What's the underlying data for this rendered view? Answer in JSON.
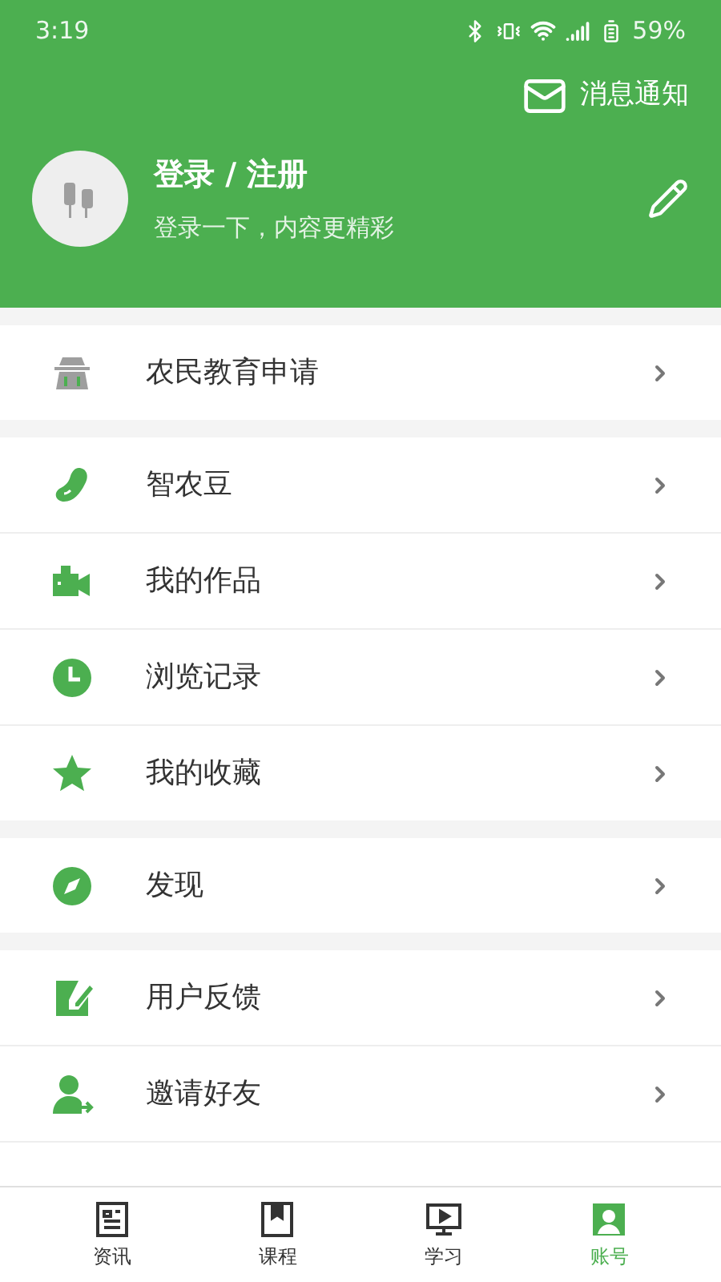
{
  "status_bar": {
    "time": "3:19",
    "battery": "59%"
  },
  "header": {
    "notification": "消息通知",
    "login_title": "登录 / 注册",
    "login_subtitle": "登录一下，内容更精彩"
  },
  "groups": [
    {
      "items": [
        "农民教育申请"
      ]
    },
    {
      "items": [
        "智农豆",
        "我的作品",
        "浏览记录",
        "我的收藏"
      ]
    },
    {
      "items": [
        "发现"
      ]
    },
    {
      "items": [
        "用户反馈",
        "邀请好友"
      ]
    }
  ],
  "tabs": [
    {
      "label": "资讯",
      "selected": false
    },
    {
      "label": "课程",
      "selected": false
    },
    {
      "label": "学习",
      "selected": false
    },
    {
      "label": "账号",
      "selected": true
    }
  ]
}
